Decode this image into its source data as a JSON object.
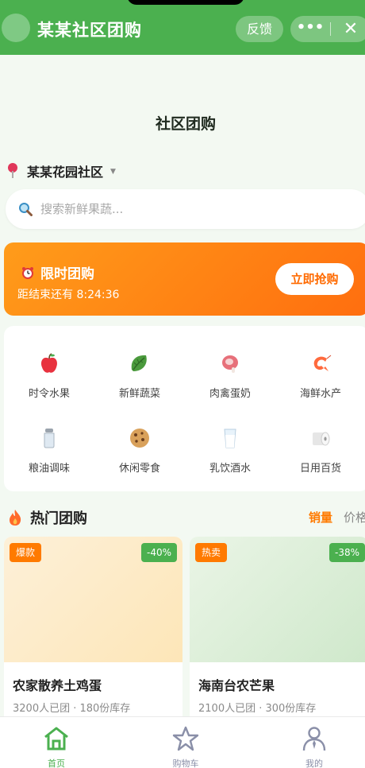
{
  "topbar": {
    "title": "某某社区团购",
    "feedback": "反馈",
    "more": "•••",
    "close": "✕"
  },
  "page": {
    "title": "社区团购"
  },
  "location": {
    "name": "某某花园社区",
    "caret": "▼"
  },
  "search": {
    "placeholder": "搜索新鲜果蔬..."
  },
  "flash": {
    "title": "限时团购",
    "countdown": "距结束还有 8:24:36",
    "button": "立即抢购"
  },
  "categories": [
    {
      "label": "时令水果",
      "icon": "apple-icon"
    },
    {
      "label": "新鲜蔬菜",
      "icon": "leafy-greens-icon"
    },
    {
      "label": "肉禽蛋奶",
      "icon": "meat-icon"
    },
    {
      "label": "海鲜水产",
      "icon": "shrimp-icon"
    },
    {
      "label": "粮油调味",
      "icon": "salt-shaker-icon"
    },
    {
      "label": "休闲零食",
      "icon": "cookie-icon"
    },
    {
      "label": "乳饮酒水",
      "icon": "milk-glass-icon"
    },
    {
      "label": "日用百货",
      "icon": "toilet-paper-icon"
    }
  ],
  "hot": {
    "title": "热门团购",
    "sort_sales": "销量",
    "sort_price": "价格"
  },
  "products": [
    {
      "tag": "爆款",
      "discount": "-40%",
      "name": "农家散养土鸡蛋",
      "meta": "3200人已团 · 180份库存",
      "tag_color": "#ff7a00"
    },
    {
      "tag": "热卖",
      "discount": "-38%",
      "name": "海南台农芒果",
      "meta": "2100人已团 · 300份库存",
      "tag_color": "#ff7a00"
    }
  ],
  "tabbar": [
    {
      "label": "首页",
      "icon": "home-icon",
      "active": true
    },
    {
      "label": "购物车",
      "icon": "star-icon",
      "active": false
    },
    {
      "label": "我的",
      "icon": "user-icon",
      "active": false
    }
  ],
  "colors": {
    "brand": "#4bb04f",
    "accent": "#ff7a00",
    "tab_inactive": "#8a8fa8"
  }
}
